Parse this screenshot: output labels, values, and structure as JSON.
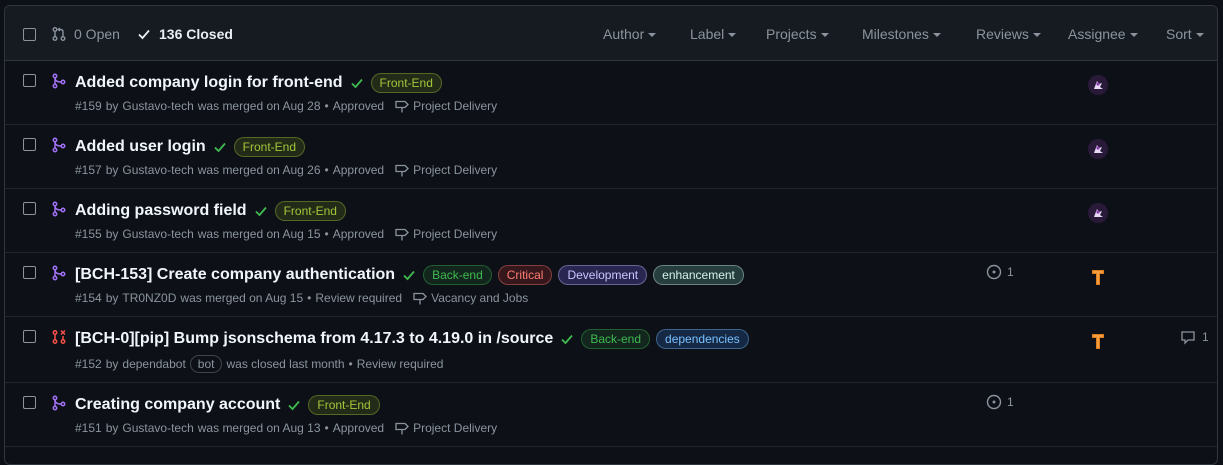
{
  "header": {
    "open_label": "0 Open",
    "closed_label": "136 Closed",
    "filters": [
      "Author",
      "Label",
      "Projects",
      "Milestones",
      "Reviews",
      "Assignee",
      "Sort"
    ]
  },
  "colors": {
    "merged": "#a371f7",
    "closed": "#f85149",
    "check": "#3fb950"
  },
  "rows": [
    {
      "title": "Added company login for front-end",
      "state": "merged",
      "labels": [
        {
          "text": "Front-End",
          "color": "#a4c639",
          "bg": "rgba(131,160,34,0.18)"
        }
      ],
      "number": "#159",
      "author": "Gustavo-tech",
      "action": "was merged on Aug 28",
      "review": "Approved",
      "milestone": "Project Delivery",
      "linked": "",
      "comments": "",
      "avatar": "purple"
    },
    {
      "title": "Added user login",
      "state": "merged",
      "labels": [
        {
          "text": "Front-End",
          "color": "#a4c639",
          "bg": "rgba(131,160,34,0.18)"
        }
      ],
      "number": "#157",
      "author": "Gustavo-tech",
      "action": "was merged on Aug 26",
      "review": "Approved",
      "milestone": "Project Delivery",
      "linked": "",
      "comments": "",
      "avatar": "purple"
    },
    {
      "title": "Adding password field",
      "state": "merged",
      "labels": [
        {
          "text": "Front-End",
          "color": "#a4c639",
          "bg": "rgba(131,160,34,0.18)"
        }
      ],
      "number": "#155",
      "author": "Gustavo-tech",
      "action": "was merged on Aug 15",
      "review": "Approved",
      "milestone": "Project Delivery",
      "linked": "",
      "comments": "",
      "avatar": "purple"
    },
    {
      "title": "[BCH-153] Create company authentication",
      "state": "merged",
      "labels": [
        {
          "text": "Back-end",
          "color": "#3fb950",
          "bg": "rgba(46,160,67,0.15)"
        },
        {
          "text": "Critical",
          "color": "#ff7b72",
          "bg": "rgba(218,54,51,0.2)"
        },
        {
          "text": "Development",
          "color": "#c9c6ff",
          "bg": "rgba(110,90,220,0.3)"
        },
        {
          "text": "enhancement",
          "color": "#d2f2e8",
          "bg": "rgba(120,200,180,0.25)"
        }
      ],
      "number": "#154",
      "author": "TR0NZ0D",
      "action": "was merged on Aug 15",
      "review": "Review required",
      "milestone": "Vacancy and Jobs",
      "linked": "1",
      "comments": "",
      "avatar": "orange"
    },
    {
      "title": "[BCH-0][pip] Bump jsonschema from 4.17.3 to 4.19.0 in /source",
      "state": "closed",
      "labels": [
        {
          "text": "Back-end",
          "color": "#3fb950",
          "bg": "rgba(46,160,67,0.15)"
        },
        {
          "text": "dependencies",
          "color": "#79c0ff",
          "bg": "rgba(56,139,253,0.2)"
        }
      ],
      "number": "#152",
      "author": "dependabot",
      "bot": "bot",
      "action": "was closed last month",
      "review": "Review required",
      "milestone": "",
      "linked": "",
      "comments": "1",
      "avatar": "orange"
    },
    {
      "title": "Creating company account",
      "state": "merged",
      "labels": [
        {
          "text": "Front-End",
          "color": "#a4c639",
          "bg": "rgba(131,160,34,0.18)"
        }
      ],
      "number": "#151",
      "author": "Gustavo-tech",
      "action": "was merged on Aug 13",
      "review": "Approved",
      "milestone": "Project Delivery",
      "linked": "1",
      "comments": "",
      "avatar": ""
    }
  ]
}
